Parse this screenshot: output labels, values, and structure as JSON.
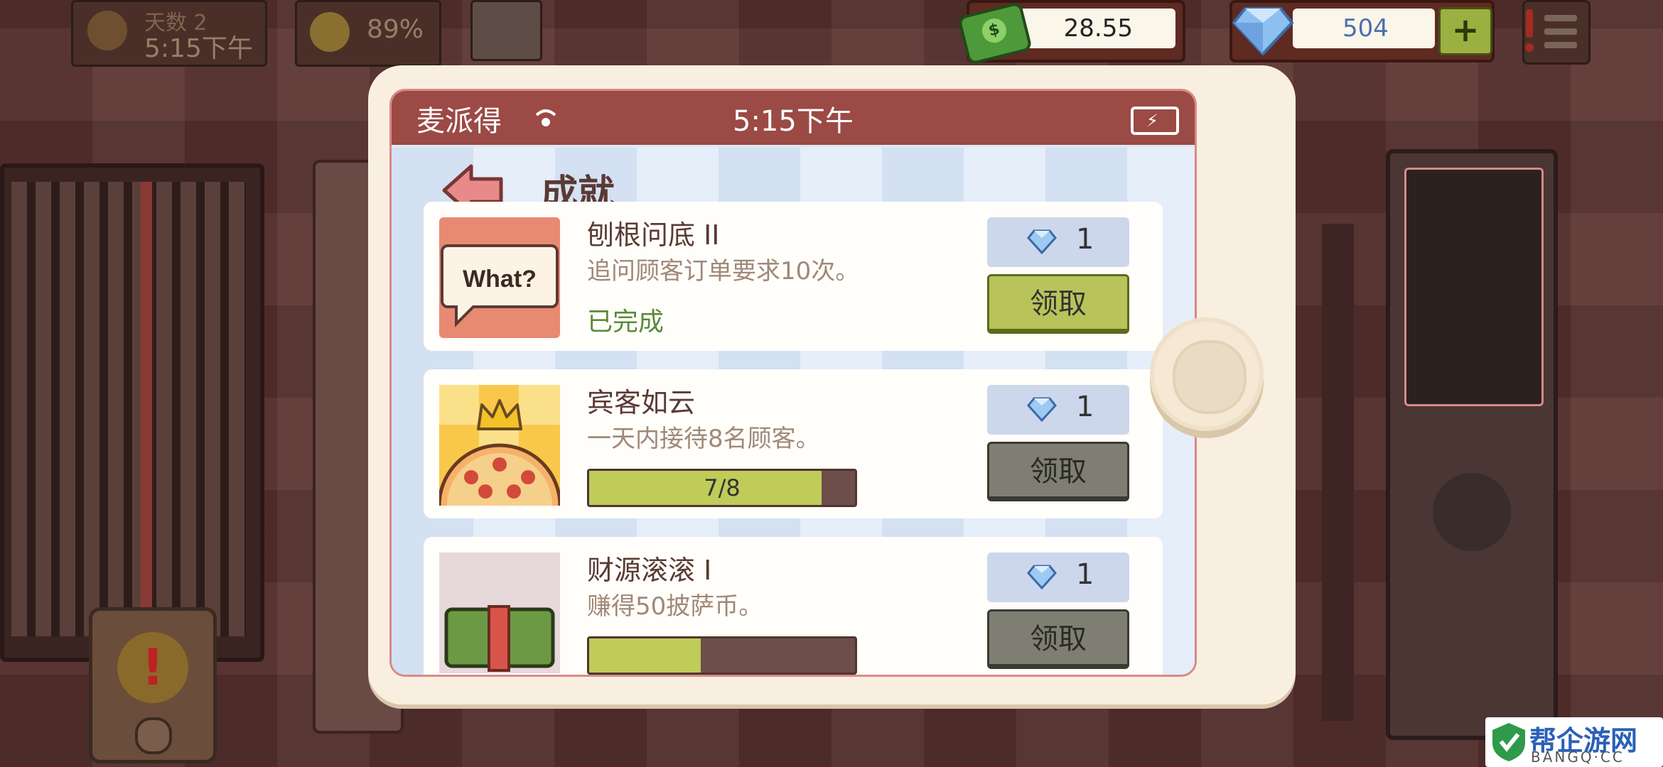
{
  "hud": {
    "day_label": "天数 2",
    "time": "5:15下午",
    "happiness": "89%",
    "cash": "28.55",
    "gems": "504",
    "add_gems_label": "+"
  },
  "phone": {
    "status_bar": {
      "app_name": "麦派得",
      "time": "5:15下午"
    },
    "page_title": "成就",
    "achievements": [
      {
        "name": "刨根问底 II",
        "description": "追问顾客订单要求10次。",
        "status_text": "已完成",
        "reward": "1",
        "claim_label": "领取",
        "thumb_text": "What?"
      },
      {
        "name": "宾客如云",
        "description": "一天内接待8名顾客。",
        "progress_text": "7/8",
        "progress": 0.875,
        "reward": "1",
        "claim_label": "领取"
      },
      {
        "name": "财源滚滚 I",
        "description": "赚得50披萨币。",
        "progress": 0.42,
        "reward": "1",
        "claim_label": "领取"
      }
    ]
  },
  "watermark": {
    "title": "帮企游网",
    "subtitle": "BANGQ·CC"
  },
  "colors": {
    "status_bar": "#9b4a45",
    "claim_active": "#b8c45a",
    "claim_inactive": "#7e7e72",
    "gem": "#6fa3e0"
  }
}
